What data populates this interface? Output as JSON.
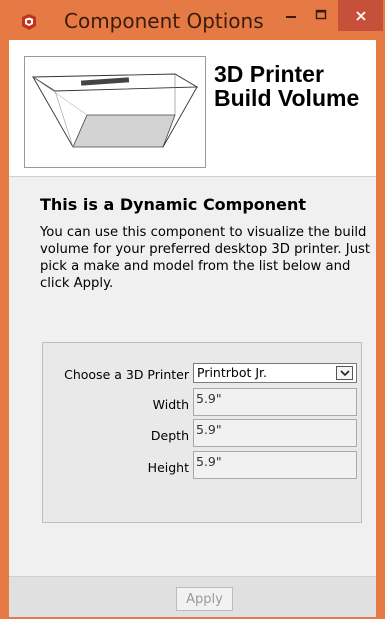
{
  "window": {
    "title": "Component Options",
    "accent_color": "#e57a44",
    "close_color": "#c7503a",
    "app_icon": "sketchup-icon"
  },
  "header": {
    "title_line1": "3D Printer",
    "title_line2": "Build Volume",
    "thumbnail_icon": "build-volume-box-icon"
  },
  "body": {
    "heading": "This is a Dynamic Component",
    "description": "You can use this component to visualize the build volume for your preferred desktop 3D printer. Just pick a make and model from the list below and click Apply."
  },
  "options": {
    "printer": {
      "label": "Choose a 3D Printer",
      "value": "Printrbot Jr."
    },
    "width": {
      "label": "Width",
      "value": "5.9\""
    },
    "depth": {
      "label": "Depth",
      "value": "5.9\""
    },
    "height": {
      "label": "Height",
      "value": "5.9\""
    }
  },
  "footer": {
    "apply_label": "Apply"
  }
}
